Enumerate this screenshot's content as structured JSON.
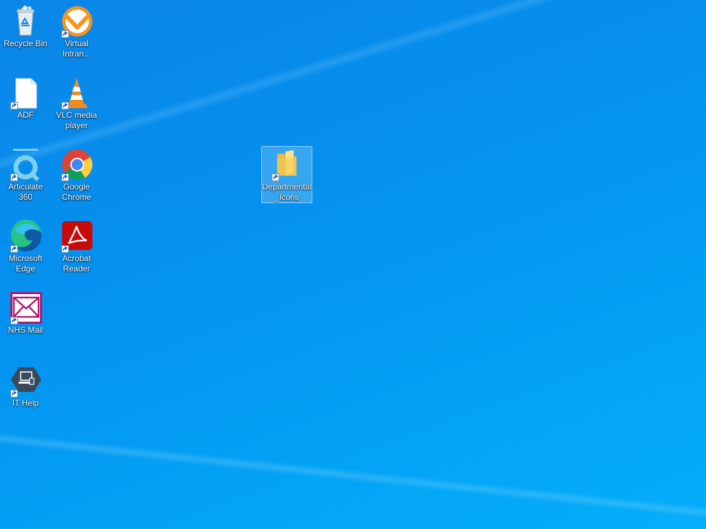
{
  "desktop": {
    "icons": [
      {
        "id": "recycle-bin",
        "label": "Recycle Bin",
        "shortcut": false
      },
      {
        "id": "virtual-intranet",
        "label": "Virtual\nIntran...",
        "shortcut": true
      },
      {
        "id": "adf",
        "label": "ADF",
        "shortcut": true
      },
      {
        "id": "vlc",
        "label": "VLC media\nplayer",
        "shortcut": true
      },
      {
        "id": "articulate",
        "label": "Articulate 360",
        "shortcut": true
      },
      {
        "id": "chrome",
        "label": "Google\nChrome",
        "shortcut": true
      },
      {
        "id": "edge",
        "label": "Microsoft\nEdge",
        "shortcut": true
      },
      {
        "id": "acrobat",
        "label": "Acrobat\nReader",
        "shortcut": true
      },
      {
        "id": "nhs-mail",
        "label": "NHS Mail",
        "shortcut": true
      },
      {
        "id": "it-help",
        "label": "IT Help",
        "shortcut": true
      },
      {
        "id": "departmental-icons",
        "label": "Departmental\n_Icons",
        "shortcut": true,
        "selected": true
      }
    ]
  },
  "colors": {
    "wallpaper": "#0591ef",
    "selection": "rgba(255,255,255,0.2)"
  }
}
